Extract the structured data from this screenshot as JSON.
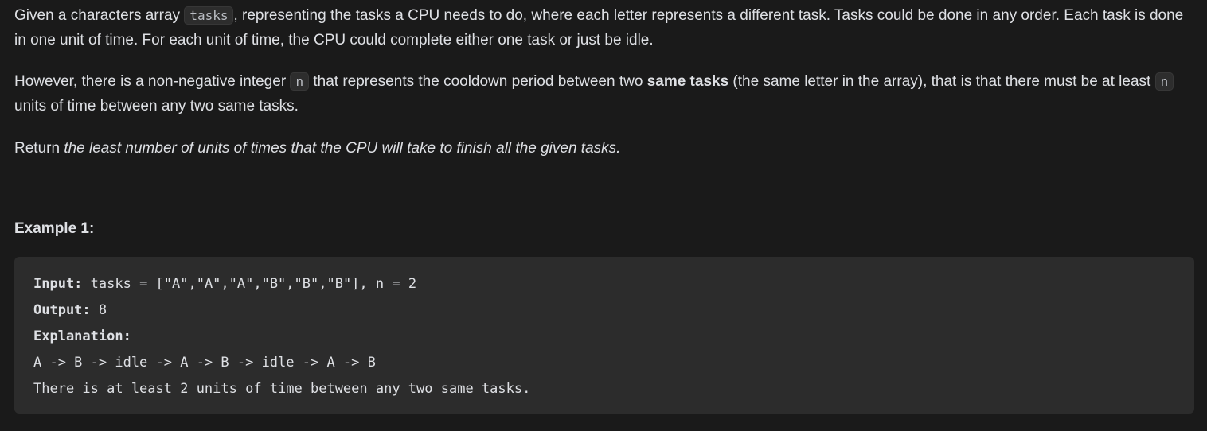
{
  "description": {
    "p1": {
      "text_before": "Given a characters array ",
      "code": "tasks",
      "text_after": ", representing the tasks a CPU needs to do, where each letter represents a different task. Tasks could be done in any order. Each task is done in one unit of time. For each unit of time, the CPU could complete either one task or just be idle."
    },
    "p2": {
      "text_before": "However, there is a non-negative integer ",
      "code1": "n",
      "text_mid": " that represents the cooldown period between two ",
      "bold": "same tasks",
      "text_mid2": " (the same letter in the array), that is that there must be at least ",
      "code2": "n",
      "text_after": " units of time between any two same tasks."
    },
    "p3": {
      "text_before": "Return ",
      "italic": "the least number of units of times that the CPU will take to finish all the given tasks."
    }
  },
  "example": {
    "heading": "Example 1:",
    "input_label": "Input:",
    "input_value": " tasks = [\"A\",\"A\",\"A\",\"B\",\"B\",\"B\"], n = 2",
    "output_label": "Output:",
    "output_value": " 8",
    "explanation_label": "Explanation:",
    "explanation_lines": [
      "A -> B -> idle -> A -> B -> idle -> A -> B",
      "There is at least 2 units of time between any two same tasks."
    ]
  }
}
